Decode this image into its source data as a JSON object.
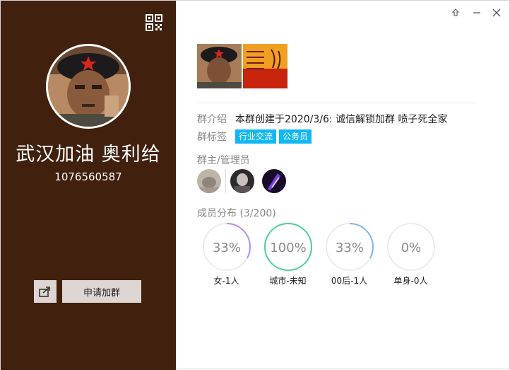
{
  "window": {
    "controls": {
      "pin_icon": "pin-icon",
      "minimize_icon": "minimize-icon",
      "close_icon": "close-icon"
    }
  },
  "colors": {
    "left_panel": "#41200e",
    "tag_bg": "#12b7f5",
    "gender_ring": "#b18ef0",
    "city_ring": "#4fd09a",
    "age_ring": "#7fb4ee",
    "single_ring": "#e2e2e2"
  },
  "profile": {
    "name": "武汉加油 奥利给",
    "group_id": "1076560587",
    "join_button": "申请加群",
    "share_icon": "share-icon",
    "qr_icon": "qr-code-icon"
  },
  "info": {
    "intro_label": "群介绍",
    "intro_text": "本群创建于2020/3/6: 诚信解锁加群 喷子死全家",
    "tags_label": "群标签",
    "tags": [
      "行业交流",
      "公务员"
    ],
    "admins_label": "群主/管理员",
    "distribution_label": "成员分布",
    "distribution_count": "(3/200)"
  },
  "stats": [
    {
      "value": "33%",
      "fraction": 0.33,
      "caption": "女-1人"
    },
    {
      "value": "100%",
      "fraction": 1.0,
      "caption": "城市-未知"
    },
    {
      "value": "33%",
      "fraction": 0.33,
      "caption": "00后-1人"
    },
    {
      "value": "0%",
      "fraction": 0.0,
      "caption": "单身-0人"
    }
  ]
}
